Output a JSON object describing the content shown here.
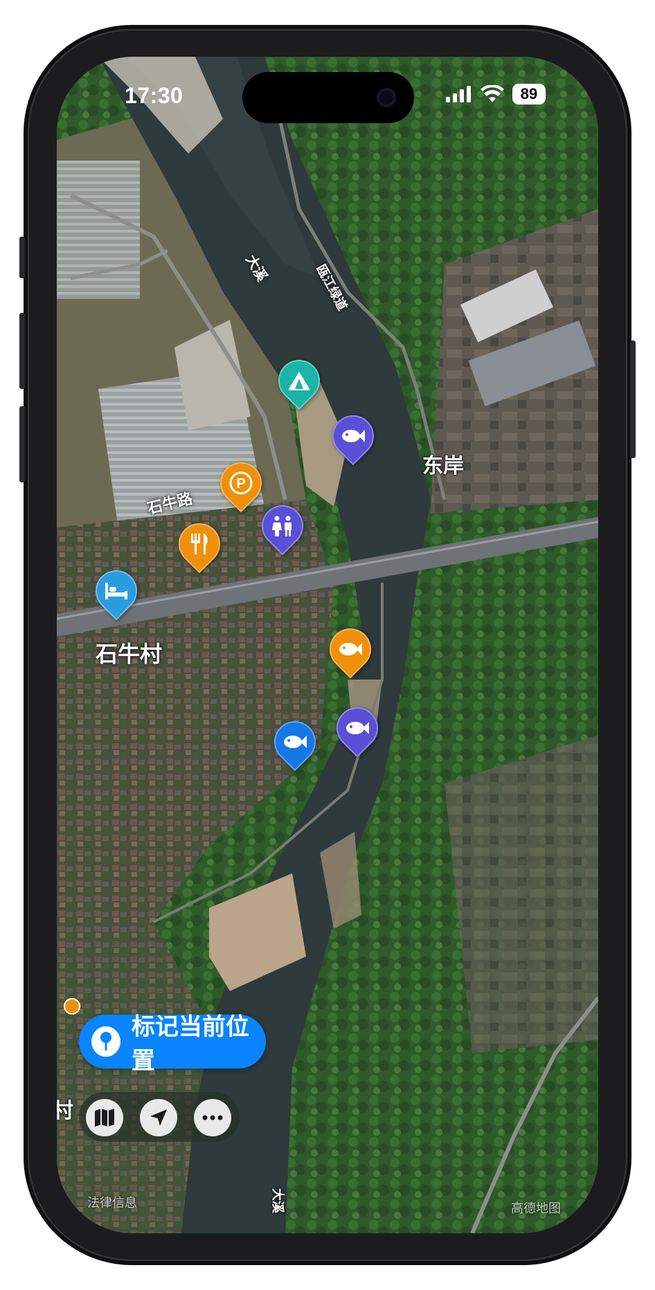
{
  "status_bar": {
    "time": "17:30",
    "battery": "89"
  },
  "map": {
    "labels": {
      "river_top": "大溪",
      "river_bottom": "大溪",
      "greenway": "瓯江绿道",
      "road": "石牛路",
      "east_bank": "东岸",
      "village": "石牛村",
      "edge_village": "村"
    },
    "pins": [
      {
        "name": "campsite",
        "icon": "tent-icon",
        "color": "#1bb5a8"
      },
      {
        "name": "fishing-spot",
        "icon": "fish-icon",
        "color": "#5a4fd6"
      },
      {
        "name": "parking",
        "icon": "parking-icon",
        "color": "#f0900a"
      },
      {
        "name": "restaurant",
        "icon": "fork-knife-icon",
        "color": "#f0900a"
      },
      {
        "name": "restroom",
        "icon": "restroom-icon",
        "color": "#5a4fd6"
      },
      {
        "name": "lodging",
        "icon": "bed-icon",
        "color": "#2a9de0"
      },
      {
        "name": "fishing-spot",
        "icon": "fish-icon",
        "color": "#f0900a"
      },
      {
        "name": "fishing-spot",
        "icon": "fish-icon",
        "color": "#5a4fd6"
      },
      {
        "name": "fishing-spot",
        "icon": "fish-icon",
        "color": "#1677e6"
      }
    ],
    "legal_info": "法律信息",
    "attribution": "高德地图"
  },
  "actions": {
    "mark_location_label": "标记当前位置"
  },
  "toolbar": {
    "buttons": [
      "map-icon",
      "location-arrow-icon",
      "more-icon"
    ]
  }
}
